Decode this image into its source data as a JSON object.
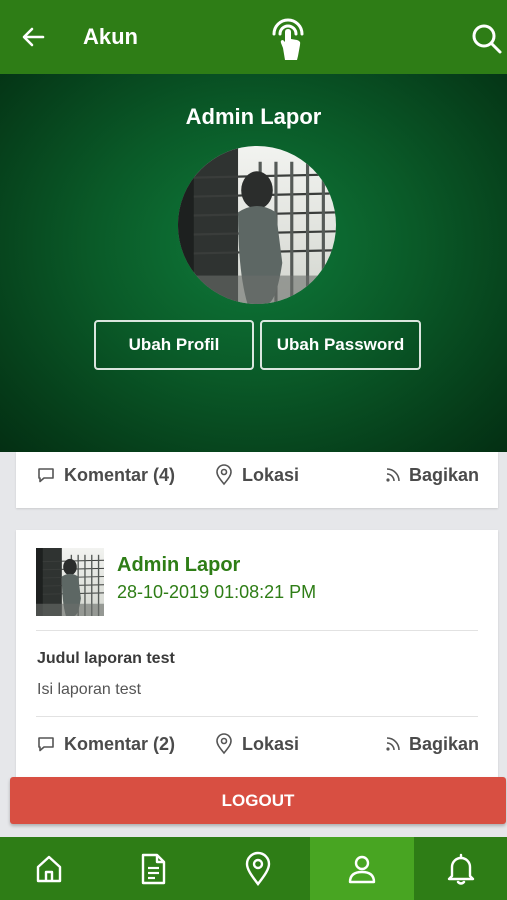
{
  "header": {
    "title": "Akun",
    "back_icon": "arrow-left-icon",
    "logo_icon": "tap-signal-icon",
    "search_icon": "search-icon",
    "bg_color": "#2e7d16"
  },
  "profile": {
    "name": "Admin Lapor",
    "edit_profile_label": "Ubah Profil",
    "change_password_label": "Ubah Password"
  },
  "previous_post": {
    "comments_label": "Komentar (4)",
    "location_label": "Lokasi",
    "share_label": "Bagikan"
  },
  "post": {
    "author": "Admin Lapor",
    "date": "28-10-2019 01:08:21 PM",
    "title": "Judul laporan test",
    "body": "Isi laporan test",
    "comments_label": "Komentar (2)",
    "location_label": "Lokasi",
    "share_label": "Bagikan"
  },
  "logout_label": "LOGOUT",
  "bottom_nav": {
    "items": [
      {
        "icon": "home-icon",
        "active": false
      },
      {
        "icon": "document-icon",
        "active": false
      },
      {
        "icon": "location-pin-icon",
        "active": false
      },
      {
        "icon": "user-icon",
        "active": true
      },
      {
        "icon": "bell-icon",
        "active": false
      }
    ],
    "accent_color": "#48a522"
  },
  "colors": {
    "primary": "#2e7d16",
    "logout": "#d84f42"
  }
}
